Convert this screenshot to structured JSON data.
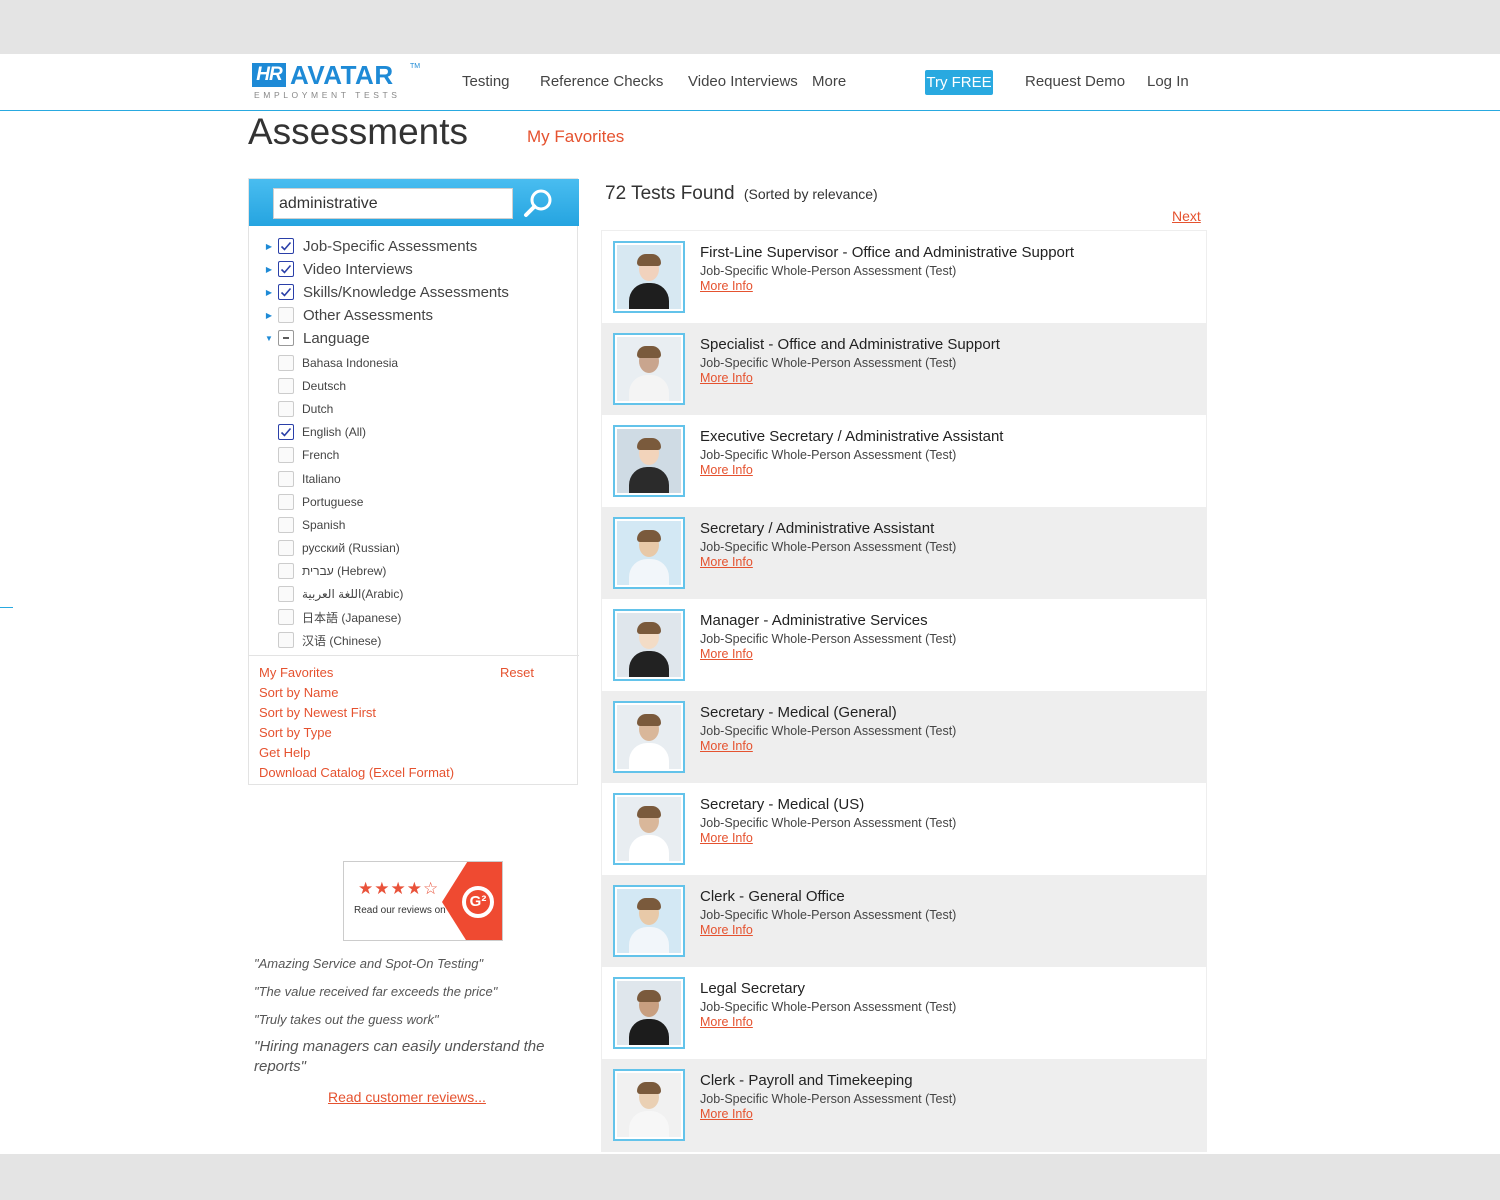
{
  "header": {
    "logo_hr": "HR",
    "logo_text": "AVATAR",
    "logo_tm": "TM",
    "logo_sub": "EMPLOYMENT TESTS",
    "nav": [
      "Testing",
      "Reference Checks",
      "Video Interviews",
      "More"
    ],
    "try_free": "Try FREE",
    "request_demo": "Request Demo",
    "log_in": "Log In",
    "accent_color": "#29a9e0"
  },
  "page": {
    "title": "Assessments",
    "favorites_link": "My Favorites"
  },
  "search": {
    "value": "administrative",
    "button_icon": "search-icon"
  },
  "filters": [
    {
      "label": "Job-Specific Assessments",
      "state": "checked",
      "expanded": false
    },
    {
      "label": "Video Interviews",
      "state": "checked",
      "expanded": false
    },
    {
      "label": "Skills/Knowledge Assessments",
      "state": "checked",
      "expanded": false
    },
    {
      "label": "Other Assessments",
      "state": "unchecked",
      "expanded": false
    },
    {
      "label": "Language",
      "state": "partial",
      "expanded": true
    }
  ],
  "languages": [
    {
      "label": "Bahasa Indonesia",
      "checked": false
    },
    {
      "label": "Deutsch",
      "checked": false
    },
    {
      "label": "Dutch",
      "checked": false
    },
    {
      "label": "English (All)",
      "checked": true
    },
    {
      "label": "French",
      "checked": false
    },
    {
      "label": "Italiano",
      "checked": false
    },
    {
      "label": "Portuguese",
      "checked": false
    },
    {
      "label": "Spanish",
      "checked": false
    },
    {
      "label": "русский (Russian)",
      "checked": false
    },
    {
      "label": "עברית (Hebrew)",
      "checked": false
    },
    {
      "label": "اللغة العربية(Arabic)",
      "checked": false
    },
    {
      "label": "日本語 (Japanese)",
      "checked": false
    },
    {
      "label": "汉语 (Chinese)",
      "checked": false
    }
  ],
  "sidebar_links": {
    "my_favorites": "My Favorites",
    "reset": "Reset",
    "sort_name": "Sort by Name",
    "sort_newest": "Sort by Newest First",
    "sort_type": "Sort by Type",
    "get_help": "Get Help",
    "download": "Download Catalog (Excel Format)"
  },
  "reviews": {
    "badge_stars": "★★★★☆",
    "badge_text": "Read our reviews on",
    "badge_logo": "G²",
    "quotes": [
      "\"Amazing Service and Spot-On Testing\"",
      "\"The value received far exceeds the price\"",
      "\"Truly takes out the guess work\"",
      "\"Hiring managers can easily understand the reports\""
    ],
    "read_link": "Read customer reviews..."
  },
  "results": {
    "count_text": "72 Tests Found",
    "sort_text": "(Sorted by relevance)",
    "next": "Next",
    "items": [
      {
        "title": "First-Line Supervisor - Office and Administrative Support",
        "type": "Job-Specific Whole-Person Assessment (Test)",
        "more": "More Info"
      },
      {
        "title": "Specialist - Office and Administrative Support",
        "type": "Job-Specific Whole-Person Assessment (Test)",
        "more": "More Info"
      },
      {
        "title": "Executive Secretary / Administrative Assistant",
        "type": "Job-Specific Whole-Person Assessment (Test)",
        "more": "More Info"
      },
      {
        "title": "Secretary / Administrative Assistant",
        "type": "Job-Specific Whole-Person Assessment (Test)",
        "more": "More Info"
      },
      {
        "title": "Manager - Administrative Services",
        "type": "Job-Specific Whole-Person Assessment (Test)",
        "more": "More Info"
      },
      {
        "title": "Secretary - Medical (General)",
        "type": "Job-Specific Whole-Person Assessment (Test)",
        "more": "More Info"
      },
      {
        "title": "Secretary - Medical (US)",
        "type": "Job-Specific Whole-Person Assessment (Test)",
        "more": "More Info"
      },
      {
        "title": "Clerk - General Office",
        "type": "Job-Specific Whole-Person Assessment (Test)",
        "more": "More Info"
      },
      {
        "title": "Legal Secretary",
        "type": "Job-Specific Whole-Person Assessment (Test)",
        "more": "More Info"
      },
      {
        "title": "Clerk - Payroll and Timekeeping",
        "type": "Job-Specific Whole-Person Assessment (Test)",
        "more": "More Info"
      }
    ]
  }
}
